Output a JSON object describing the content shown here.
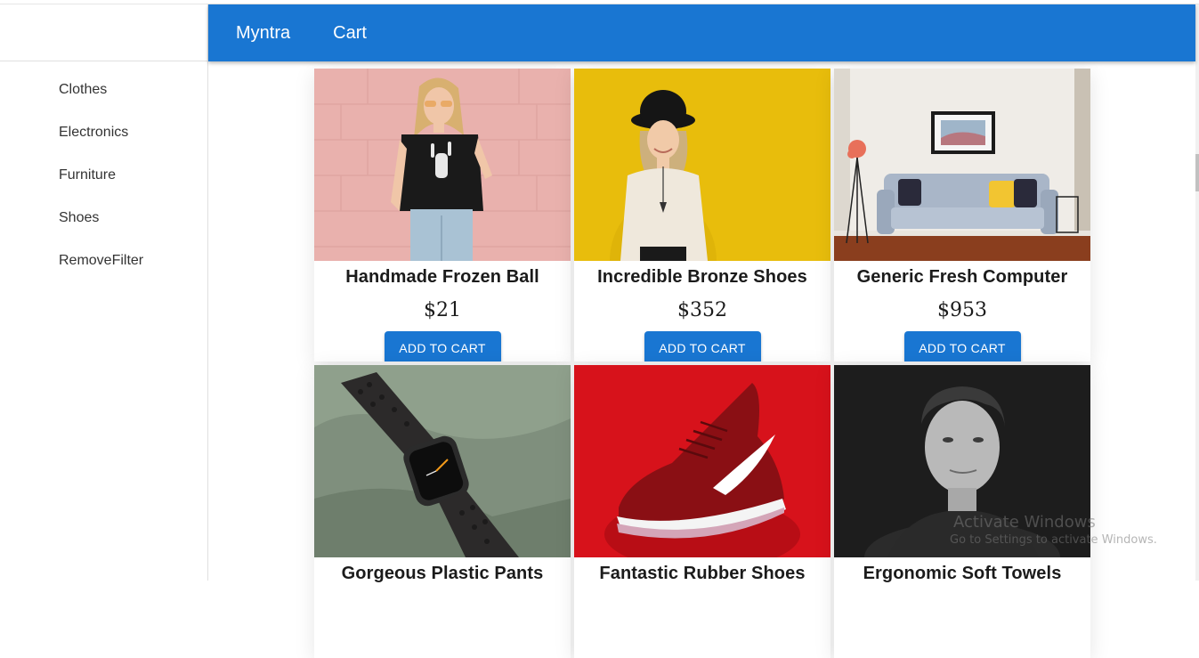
{
  "appbar": {
    "brand": "Myntra",
    "cart": "Cart",
    "color": "#1976d2"
  },
  "sidebar": {
    "items": [
      {
        "label": "Clothes"
      },
      {
        "label": "Electronics"
      },
      {
        "label": "Furniture"
      },
      {
        "label": "Shoes"
      },
      {
        "label": "RemoveFilter"
      }
    ]
  },
  "products": [
    {
      "title": "Handmade Frozen Ball",
      "price": "$21",
      "button": "ADD TO CART",
      "image": "woman-pink-wall-tshirt"
    },
    {
      "title": "Incredible Bronze Shoes",
      "price": "$352",
      "button": "ADD TO CART",
      "image": "woman-hat-yellow-wall"
    },
    {
      "title": "Generic Fresh Computer",
      "price": "$953",
      "button": "ADD TO CART",
      "image": "grey-sofa-living-room"
    },
    {
      "title": "Gorgeous Plastic Pants",
      "price": "",
      "button": "",
      "image": "smartwatch-green-fabric"
    },
    {
      "title": "Fantastic Rubber Shoes",
      "price": "",
      "button": "",
      "image": "red-sneaker"
    },
    {
      "title": "Ergonomic Soft Towels",
      "price": "",
      "button": "",
      "image": "woman-portrait-bw"
    }
  ],
  "watermark": {
    "title": "Activate Windows",
    "subtitle": "Go to Settings to activate Windows."
  }
}
